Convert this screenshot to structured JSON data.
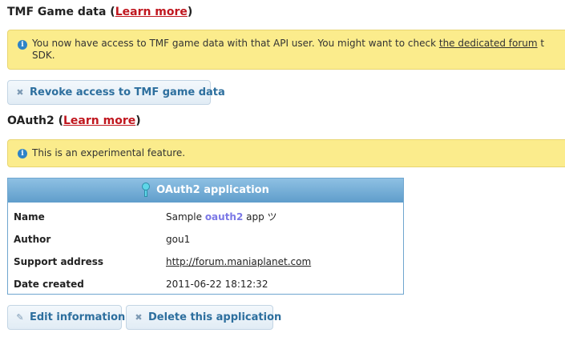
{
  "tmf": {
    "heading_prefix": "TMF Game data (",
    "learn_more": "Learn more",
    "heading_suffix": ")",
    "notice_text": "You now have access to TMF game data with that API user. You might want to check ",
    "notice_link": "the dedicated forum",
    "notice_text_tail": " t",
    "notice_line2": "SDK.",
    "revoke_button": "Revoke access to TMF game data"
  },
  "oauth": {
    "heading_prefix": "OAuth2 (",
    "learn_more": "Learn more",
    "heading_suffix": ")",
    "notice_text": "This is an experimental feature."
  },
  "application": {
    "header": "OAuth2 application",
    "rows": [
      {
        "label": "Name",
        "value_prefix": "Sample ",
        "value_highlight": "oauth2",
        "value_suffix": " app ツ"
      },
      {
        "label": "Author",
        "value": "gou1"
      },
      {
        "label": "Support address",
        "value": "http://forum.maniaplanet.com"
      },
      {
        "label": "Date created",
        "value": "2011-06-22 18:12:32"
      }
    ]
  },
  "actions": {
    "edit_button": "Edit information",
    "delete_button": "Delete this application"
  },
  "icons": {
    "info": "info-icon",
    "revoke": "close-icon",
    "key": "key-icon",
    "edit": "pencil-icon",
    "delete": "close-icon"
  },
  "colors": {
    "heading_link": "#c0171f",
    "notice_background": "#fbec8c",
    "button_text": "#2d6f9e",
    "table_header": "#6fa6cf",
    "name_highlight": "#7b78e6"
  }
}
